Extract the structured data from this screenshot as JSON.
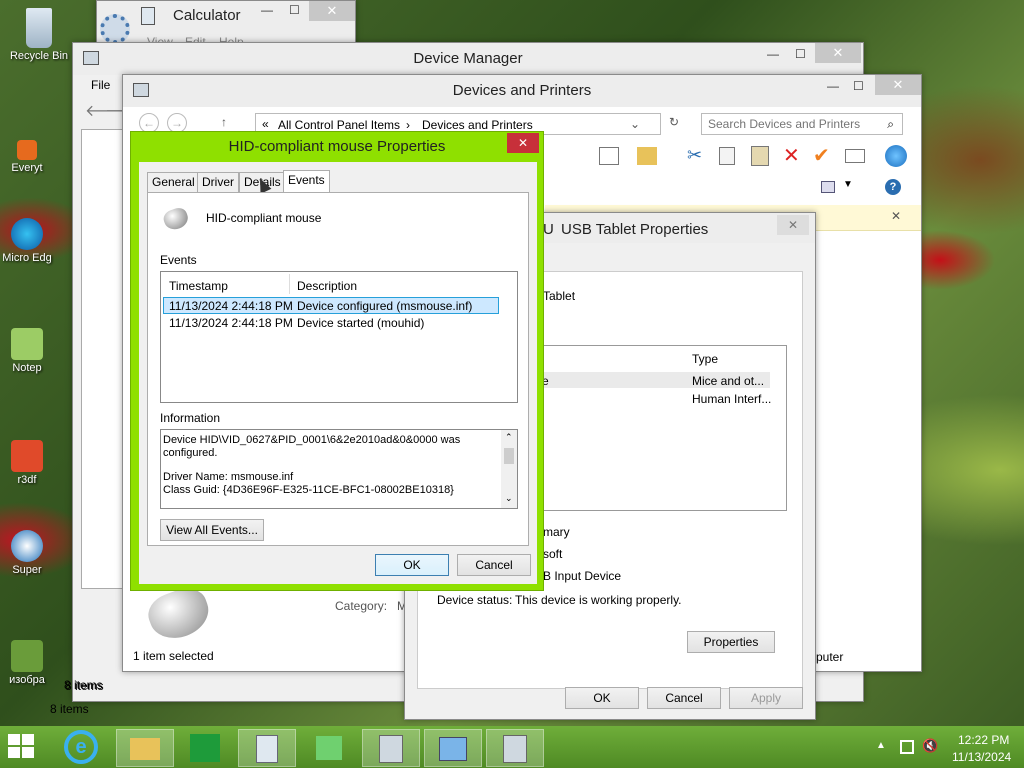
{
  "desktop": {
    "icons": [
      {
        "label": "Recycle Bin"
      },
      {
        "label": "Everyt"
      },
      {
        "label": "Micro Edg"
      },
      {
        "label": "Notep"
      },
      {
        "label": "r3df"
      },
      {
        "label": "Super"
      },
      {
        "label": "изобра"
      }
    ]
  },
  "calculator": {
    "title": "Calculator",
    "menu": [
      "View",
      "Edit",
      "Help"
    ]
  },
  "device_manager": {
    "title": "Device Manager",
    "menu_file": "File",
    "status": "8 items",
    "status2": "8 items"
  },
  "devices_printers": {
    "title": "Devices and Printers",
    "breadcrumb": [
      "All Control Panel Items",
      "Devices and Printers"
    ],
    "search_placeholder": "Search Devices and Printers",
    "category_label": "Category:",
    "category_value": "M",
    "status": "1 item selected",
    "help": "?"
  },
  "usb_props": {
    "title": "USB Tablet Properties",
    "title_prefix": "U",
    "device_name": "Tablet",
    "col_type": "Type",
    "rows": [
      {
        "name": "se",
        "type": "Mice and ot..."
      },
      {
        "name": "",
        "type": "Human Interf..."
      }
    ],
    "summary_label": "mary",
    "manufacturer": "soft",
    "location": "B Input Device",
    "status_label": "Device status:",
    "status_value": "This device is working properly.",
    "props_btn": "Properties",
    "ok": "OK",
    "cancel": "Cancel",
    "apply": "Apply",
    "right_text": "puter"
  },
  "mouse_props": {
    "title": "HID-compliant mouse Properties",
    "tabs": [
      "General",
      "Driver",
      "Details",
      "Events"
    ],
    "device_name": "HID-compliant mouse",
    "events_label": "Events",
    "col_timestamp": "Timestamp",
    "col_description": "Description",
    "events": [
      {
        "timestamp": "11/13/2024 2:44:18 PM",
        "description": "Device configured (msmouse.inf)"
      },
      {
        "timestamp": "11/13/2024 2:44:18 PM",
        "description": "Device started (mouhid)"
      }
    ],
    "info_label": "Information",
    "info_lines": [
      "Device HID\\VID_0627&PID_0001\\6&2e2010ad&0&0000 was",
      "configured.",
      "",
      "Driver Name: msmouse.inf",
      "Class Guid: {4D36E96F-E325-11CE-BFC1-08002BE10318}"
    ],
    "view_all": "View All Events...",
    "ok": "OK",
    "cancel": "Cancel"
  },
  "taskbar": {
    "time": "12:22 PM",
    "date": "11/13/2024"
  },
  "colors": {
    "accent_border": "#8fe000",
    "selection": "#cde8ff",
    "taskbar": "#5d9b2f"
  }
}
